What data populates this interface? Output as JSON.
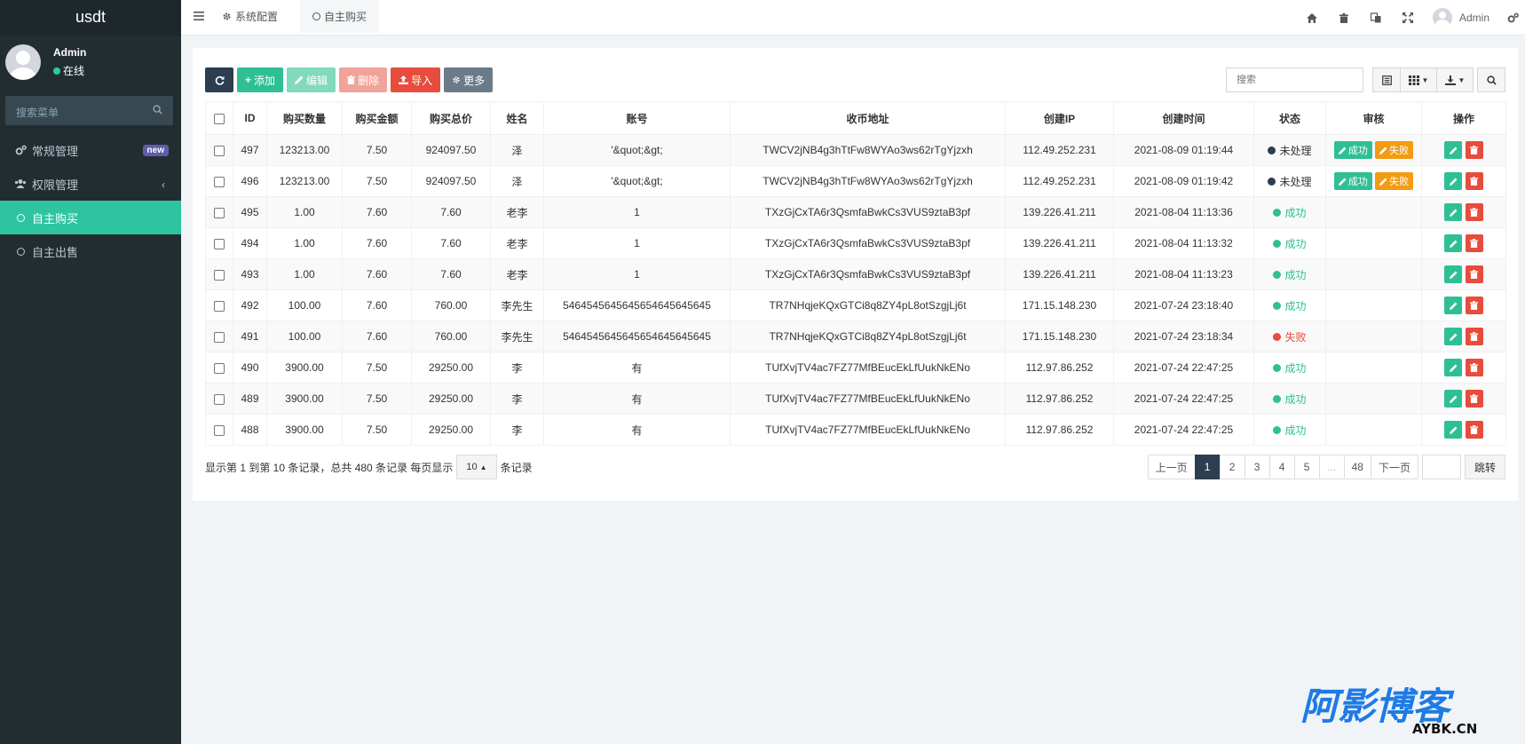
{
  "sidebar": {
    "logo": "usdt",
    "user_name": "Admin",
    "user_status": "在线",
    "search_placeholder": "搜索菜单",
    "items": [
      {
        "label": "常规管理",
        "badge": "new"
      },
      {
        "label": "权限管理"
      },
      {
        "label": "自主购买"
      },
      {
        "label": "自主出售"
      }
    ]
  },
  "topbar": {
    "tabs": [
      {
        "label": "系统配置"
      },
      {
        "label": "自主购买"
      }
    ],
    "user_name": "Admin"
  },
  "toolbar": {
    "add": "添加",
    "edit": "编辑",
    "delete": "删除",
    "import": "导入",
    "more": "更多",
    "search_placeholder": "搜索"
  },
  "table": {
    "headers": [
      "ID",
      "购买数量",
      "购买金额",
      "购买总价",
      "姓名",
      "账号",
      "收币地址",
      "创建IP",
      "创建时间",
      "状态",
      "审核",
      "操作"
    ],
    "audit_success": "成功",
    "audit_fail": "失败",
    "rows": [
      {
        "id": "497",
        "qty": "123213.00",
        "amount": "7.50",
        "total": "924097.50",
        "name": "泽",
        "account": "'&quot;&gt;",
        "address": "TWCV2jNB4g3hTtFw8WYAo3ws62rTgYjzxh",
        "ip": "112.49.252.231",
        "time": "2021-08-09 01:19:44",
        "status": "未处理",
        "status_color": "#2c3e50",
        "pending": true
      },
      {
        "id": "496",
        "qty": "123213.00",
        "amount": "7.50",
        "total": "924097.50",
        "name": "泽",
        "account": "'&quot;&gt;",
        "address": "TWCV2jNB4g3hTtFw8WYAo3ws62rTgYjzxh",
        "ip": "112.49.252.231",
        "time": "2021-08-09 01:19:42",
        "status": "未处理",
        "status_color": "#2c3e50",
        "pending": true
      },
      {
        "id": "495",
        "qty": "1.00",
        "amount": "7.60",
        "total": "7.60",
        "name": "老李",
        "account": "1",
        "address": "TXzGjCxTA6r3QsmfaBwkCs3VUS9ztaB3pf",
        "ip": "139.226.41.211",
        "time": "2021-08-04 11:13:36",
        "status": "成功",
        "status_color": "#2fbf94",
        "pending": false
      },
      {
        "id": "494",
        "qty": "1.00",
        "amount": "7.60",
        "total": "7.60",
        "name": "老李",
        "account": "1",
        "address": "TXzGjCxTA6r3QsmfaBwkCs3VUS9ztaB3pf",
        "ip": "139.226.41.211",
        "time": "2021-08-04 11:13:32",
        "status": "成功",
        "status_color": "#2fbf94",
        "pending": false
      },
      {
        "id": "493",
        "qty": "1.00",
        "amount": "7.60",
        "total": "7.60",
        "name": "老李",
        "account": "1",
        "address": "TXzGjCxTA6r3QsmfaBwkCs3VUS9ztaB3pf",
        "ip": "139.226.41.211",
        "time": "2021-08-04 11:13:23",
        "status": "成功",
        "status_color": "#2fbf94",
        "pending": false
      },
      {
        "id": "492",
        "qty": "100.00",
        "amount": "7.60",
        "total": "760.00",
        "name": "李先生",
        "account": "5464545645645654645645645",
        "address": "TR7NHqjeKQxGTCi8q8ZY4pL8otSzgjLj6t",
        "ip": "171.15.148.230",
        "time": "2021-07-24 23:18:40",
        "status": "成功",
        "status_color": "#2fbf94",
        "pending": false
      },
      {
        "id": "491",
        "qty": "100.00",
        "amount": "7.60",
        "total": "760.00",
        "name": "李先生",
        "account": "5464545645645654645645645",
        "address": "TR7NHqjeKQxGTCi8q8ZY4pL8otSzgjLj6t",
        "ip": "171.15.148.230",
        "time": "2021-07-24 23:18:34",
        "status": "失败",
        "status_color": "#e74c3c",
        "pending": false
      },
      {
        "id": "490",
        "qty": "3900.00",
        "amount": "7.50",
        "total": "29250.00",
        "name": "李",
        "account": "有",
        "address": "TUfXvjTV4ac7FZ77MfBEucEkLfUukNkENo",
        "ip": "112.97.86.252",
        "time": "2021-07-24 22:47:25",
        "status": "成功",
        "status_color": "#2fbf94",
        "pending": false
      },
      {
        "id": "489",
        "qty": "3900.00",
        "amount": "7.50",
        "total": "29250.00",
        "name": "李",
        "account": "有",
        "address": "TUfXvjTV4ac7FZ77MfBEucEkLfUukNkENo",
        "ip": "112.97.86.252",
        "time": "2021-07-24 22:47:25",
        "status": "成功",
        "status_color": "#2fbf94",
        "pending": false
      },
      {
        "id": "488",
        "qty": "3900.00",
        "amount": "7.50",
        "total": "29250.00",
        "name": "李",
        "account": "有",
        "address": "TUfXvjTV4ac7FZ77MfBEucEkLfUukNkENo",
        "ip": "112.97.86.252",
        "time": "2021-07-24 22:47:25",
        "status": "成功",
        "status_color": "#2fbf94",
        "pending": false
      }
    ]
  },
  "footer": {
    "info_prefix": "显示第 1 到第 10 条记录，总共 480 条记录 每页显示",
    "page_size": "10",
    "info_suffix": "条记录",
    "prev": "上一页",
    "pages": [
      "1",
      "2",
      "3",
      "4",
      "5",
      "...",
      "48"
    ],
    "next": "下一页",
    "jump": "跳转"
  },
  "watermark": {
    "title": "阿影博客",
    "domain": "AYBK.CN"
  }
}
